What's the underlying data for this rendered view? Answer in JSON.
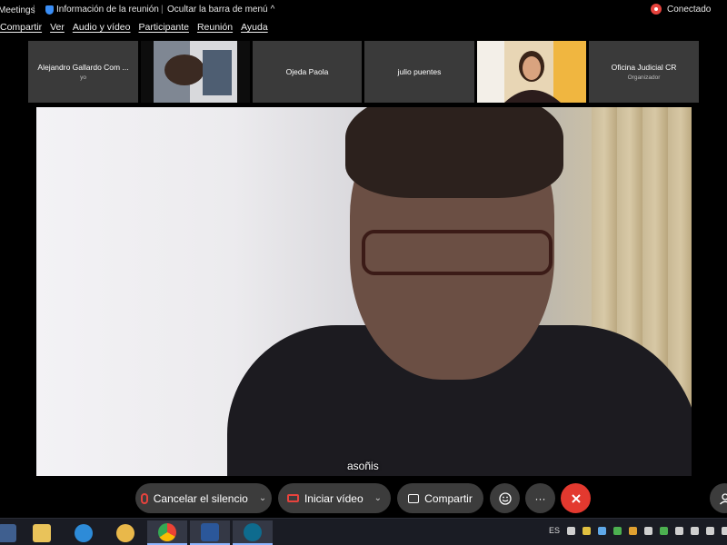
{
  "topbar": {
    "app_title": "Meetings",
    "sep1": "|",
    "meeting_info": "Información de la reunión",
    "sep2": "|",
    "hide_menu": "Ocultar la barra de menú",
    "hide_menu_chevron": "^",
    "status": "Conectado"
  },
  "menubar": {
    "items": [
      "Compartir",
      "Ver",
      "Audio y vídeo",
      "Participante",
      "Reunión",
      "Ayuda"
    ]
  },
  "participants": [
    {
      "name": "Alejandro Gallardo Com ...",
      "sub": "yo"
    },
    {
      "name": "",
      "sub": ""
    },
    {
      "name": "Ojeda Paola",
      "sub": ""
    },
    {
      "name": "julio puentes",
      "sub": ""
    },
    {
      "name": "",
      "sub": ""
    },
    {
      "name": "Oficina Judicial CR",
      "sub": "Organizador"
    }
  ],
  "main_video": {
    "caption": "asoñis"
  },
  "controls": {
    "mute_label": "Cancelar el silencio",
    "video_label": "Iniciar vídeo",
    "share_label": "Compartir",
    "reactions_icon": "smiley-icon",
    "more_label": "···",
    "end_icon": "close-icon"
  },
  "taskbar": {
    "lang": "ES",
    "apps": [
      "file-explorer-icon",
      "internet-explorer-icon",
      "paint-icon",
      "chrome-icon",
      "word-icon",
      "webex-icon"
    ]
  },
  "colors": {
    "accent_red": "#e3392f",
    "control_bg": "#3c3c3c",
    "tile_bg": "#3a3a3a"
  }
}
